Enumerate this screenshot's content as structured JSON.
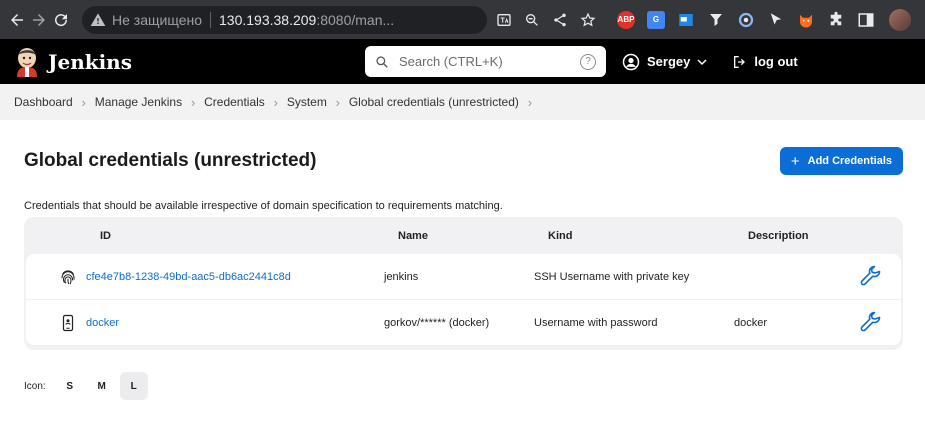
{
  "browser": {
    "insecure_label": "Не защищено",
    "url_host": "130.193.38.209",
    "url_rest": ":8080/man...",
    "extensions": [
      {
        "name": "adblock-icon",
        "text": "ABP",
        "color": "#e0312a"
      },
      {
        "name": "translate-icon",
        "text": "G",
        "color": "#4285f4"
      }
    ]
  },
  "header": {
    "title": "Jenkins",
    "search_placeholder": "Search (CTRL+K)",
    "help": "?",
    "user": "Sergey",
    "logout": "log out"
  },
  "breadcrumbs": [
    "Dashboard",
    "Manage Jenkins",
    "Credentials",
    "System",
    "Global credentials (unrestricted)"
  ],
  "page": {
    "title": "Global credentials (unrestricted)",
    "add_button": "Add Credentials",
    "description": "Credentials that should be available irrespective of domain specification to requirements matching."
  },
  "table": {
    "columns": {
      "id": "ID",
      "name": "Name",
      "kind": "Kind",
      "description": "Description"
    },
    "rows": [
      {
        "icon": "fingerprint-icon",
        "id": "cfe4e7b8-1238-49bd-aac5-db6ac2441c8d",
        "name": "jenkins",
        "kind": "SSH Username with private key",
        "description": ""
      },
      {
        "icon": "phone-badge-icon",
        "id": "docker",
        "name": "gorkov/****** (docker)",
        "kind": "Username with password",
        "description": "docker"
      }
    ]
  },
  "icon_size": {
    "label": "Icon:",
    "options": [
      "S",
      "M",
      "L"
    ],
    "selected": "L"
  },
  "colors": {
    "accent": "#0b6ed6",
    "header_bg": "#000000",
    "crumb_bg": "#f2f2f3"
  }
}
